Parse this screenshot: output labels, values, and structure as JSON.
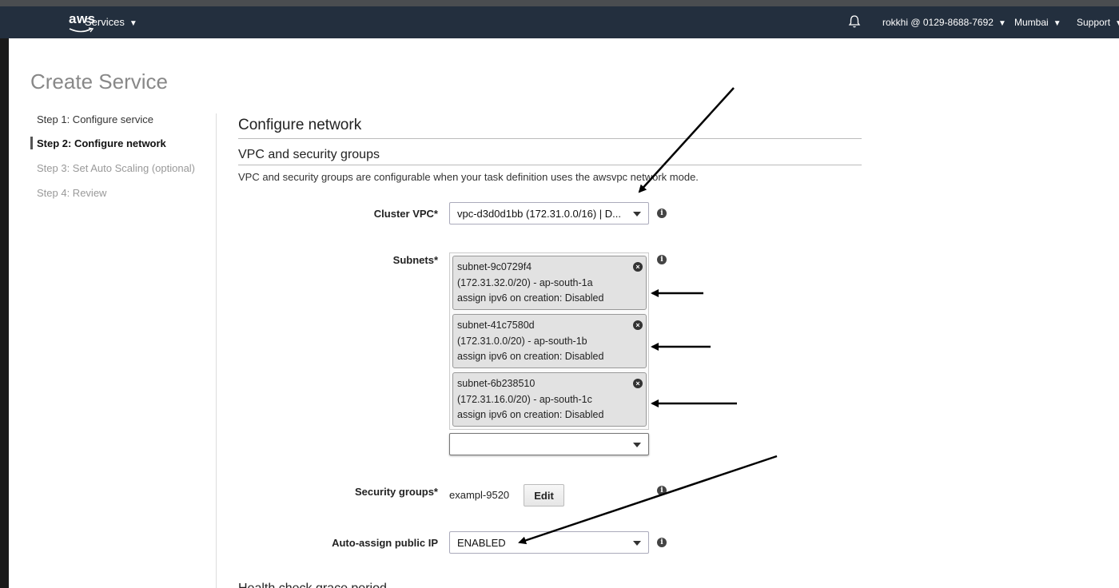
{
  "nav": {
    "logo": "aws",
    "services": "Services",
    "account": "rokkhi @ 0129-8688-7692",
    "region": "Mumbai",
    "support": "Support"
  },
  "page": {
    "title": "Create Service"
  },
  "steps": [
    {
      "label": "Step 1: Configure service",
      "state": "done"
    },
    {
      "label": "Step 2: Configure network",
      "state": "active"
    },
    {
      "label": "Step 3: Set Auto Scaling (optional)",
      "state": "pending"
    },
    {
      "label": "Step 4: Review",
      "state": "pending"
    }
  ],
  "main": {
    "heading": "Configure network",
    "subheading": "VPC and security groups",
    "description": "VPC and security groups are configurable when your task definition uses the awsvpc network mode.",
    "cluster_vpc": {
      "label": "Cluster VPC*",
      "value": "vpc-d3d0d1bb (172.31.0.0/16) | D..."
    },
    "subnets": {
      "label": "Subnets*",
      "items": [
        {
          "id": "subnet-9c0729f4",
          "cidr": "(172.31.32.0/20) - ap-south-1a",
          "ipv6": "assign ipv6 on creation: Disabled"
        },
        {
          "id": "subnet-41c7580d",
          "cidr": "(172.31.0.0/20) - ap-south-1b",
          "ipv6": "assign ipv6 on creation: Disabled"
        },
        {
          "id": "subnet-6b238510",
          "cidr": "(172.31.16.0/20) - ap-south-1c",
          "ipv6": "assign ipv6 on creation: Disabled"
        }
      ],
      "empty_select": ""
    },
    "security_groups": {
      "label": "Security groups*",
      "value": "exampl-9520",
      "edit": "Edit"
    },
    "auto_assign": {
      "label": "Auto-assign public IP",
      "value": "ENABLED"
    },
    "next_heading_partial": "Health check grace period"
  }
}
